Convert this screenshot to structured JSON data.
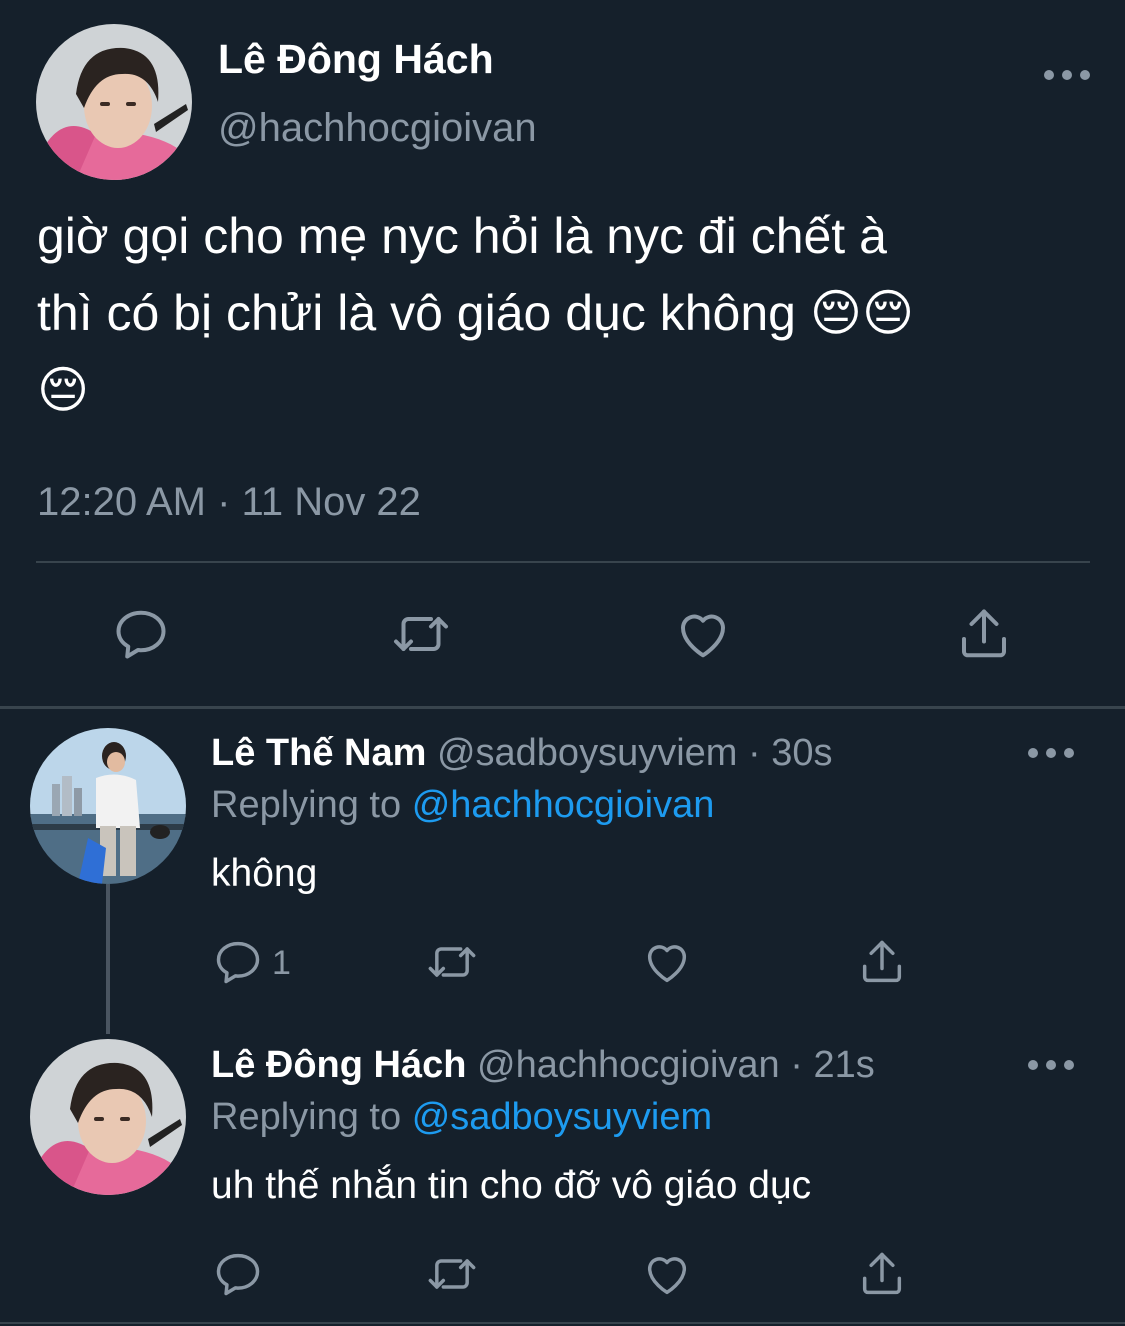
{
  "main_tweet": {
    "author_name": "Lê Đông Hách",
    "author_handle": "@hachhocgioivan",
    "text_line1": "giờ gọi cho mẹ nyc hỏi là nyc đi chết à",
    "text_line2": "thì có bị chửi là vô giáo dục không 😔😔",
    "text_line3": "😔",
    "timestamp": "12:20 AM · 11 Nov 22",
    "icons": [
      "reply-icon",
      "retweet-icon",
      "like-icon",
      "share-icon",
      "more-icon"
    ]
  },
  "replies": [
    {
      "author_name": "Lê Thế Nam",
      "author_handle": "@sadboysuyviem",
      "time": "· 30s",
      "replying_prefix": "Replying to",
      "replying_to": "@hachhocgioivan",
      "text": "không",
      "reply_count": "1"
    },
    {
      "author_name": "Lê Đông Hách",
      "author_handle": "@hachhocgioivan",
      "time": "· 21s",
      "replying_prefix": "Replying to",
      "replying_to": "@sadboysuyviem",
      "text": "uh thế nhắn tin cho đỡ vô giáo dục",
      "reply_count": ""
    }
  ],
  "colors": {
    "background": "#15202b",
    "text_primary": "#ffffff",
    "text_secondary": "#8b98a5",
    "accent": "#1d9bf0",
    "divider": "#38444d"
  }
}
